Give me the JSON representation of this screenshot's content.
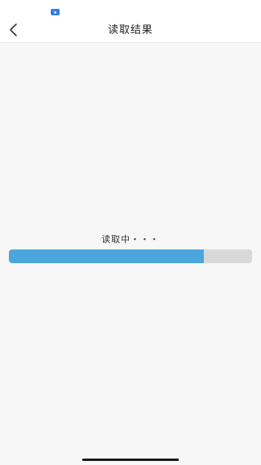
{
  "header": {
    "title": "读取结果",
    "back_icon": "chevron-left-icon"
  },
  "loading": {
    "text": "读取中・・・",
    "progress": 0.8
  },
  "colors": {
    "progress_fill": "#4aa6dd",
    "progress_track": "#d8d8d8",
    "status_indicator": "#2f7fe0"
  }
}
